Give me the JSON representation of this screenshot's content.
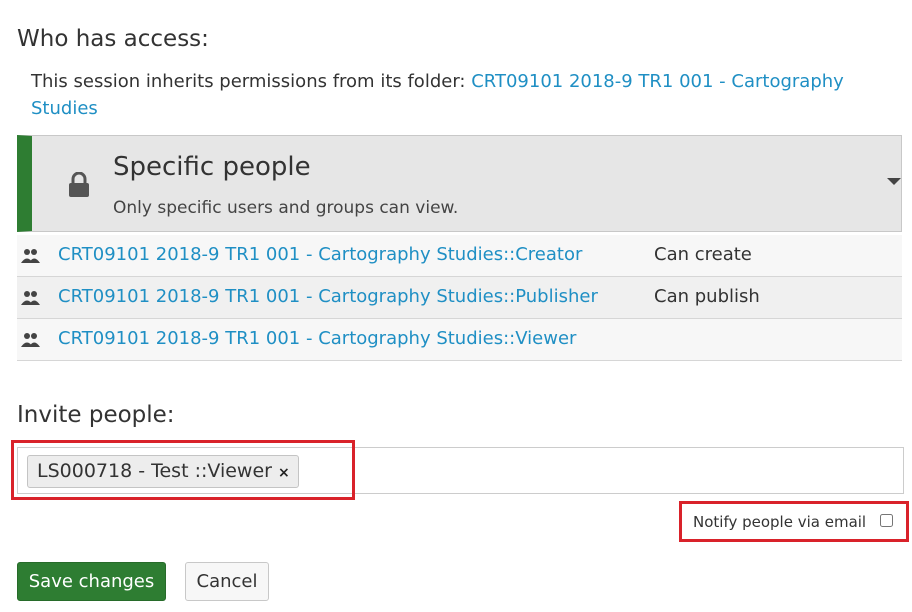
{
  "access": {
    "heading": "Who has access:",
    "inherit_text": "This session inherits permissions from its folder: ",
    "folder_link": "CRT09101 2018-9 TR1 001 - Cartography Studies"
  },
  "permission": {
    "title": "Specific people",
    "description": "Only specific users and groups can view.",
    "icon": "lock-icon",
    "dropdown_icon": "caret-down-icon",
    "accent_color": "#2e7d32"
  },
  "grants": [
    {
      "name": "CRT09101 2018-9 TR1 001 - Cartography Studies::Creator",
      "level": "Can create"
    },
    {
      "name": "CRT09101 2018-9 TR1 001 - Cartography Studies::Publisher",
      "level": "Can publish"
    },
    {
      "name": "CRT09101 2018-9 TR1 001 - Cartography Studies::Viewer",
      "level": ""
    }
  ],
  "invite": {
    "heading": "Invite people:",
    "token": "LS000718 - Test ::Viewer",
    "token_remove": "×",
    "notify_label": "Notify people via email",
    "notify_checked": false
  },
  "actions": {
    "save_label": "Save changes",
    "cancel_label": "Cancel"
  },
  "colors": {
    "link": "#1f8fc4",
    "primary_button": "#2e7d32",
    "highlight": "#d9222a"
  }
}
